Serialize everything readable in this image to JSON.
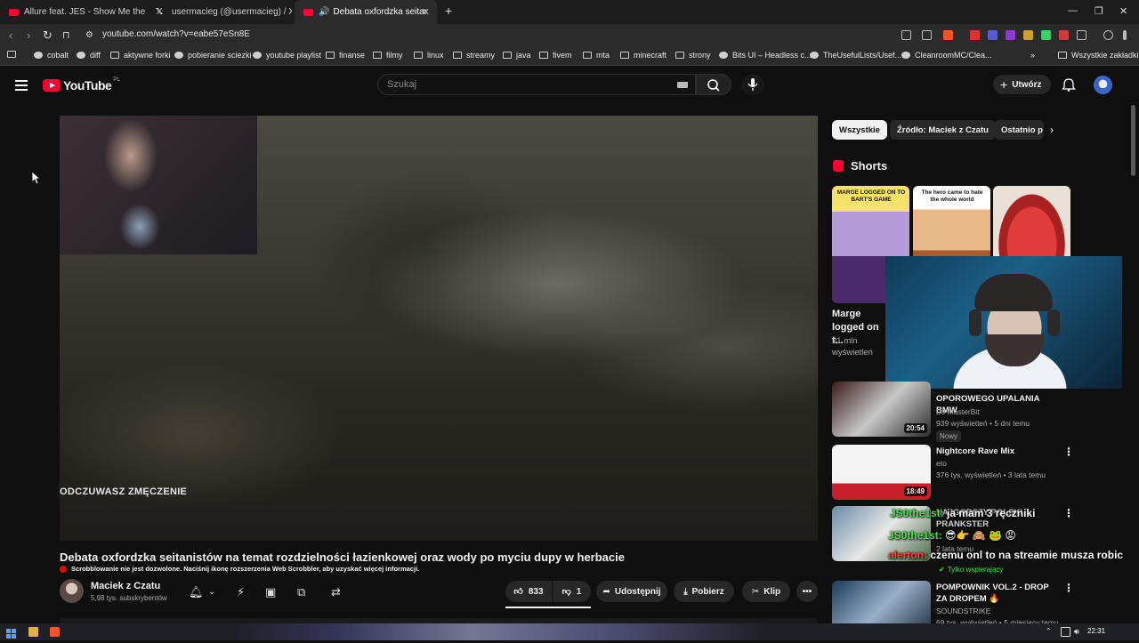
{
  "browser": {
    "tabs": [
      {
        "title": "Allure feat. JES - Show Me the Way (I"
      },
      {
        "title": "usermacieg (@usermacieg) / X"
      },
      {
        "title": "Debata oxfordzka seitanistów"
      }
    ],
    "url": "youtube.com/watch?v=eabe57eSn8E",
    "bookmarks": [
      "cobalt",
      "diff",
      "aktywne forki",
      "pobieranie sciezki",
      "youtube playlist",
      "finanse",
      "filmy",
      "linux",
      "streamy",
      "java",
      "fivem",
      "mta",
      "minecraft",
      "strony",
      "Bits UI – Headless c...",
      "TheUsefulLists/Usef...",
      "CleanroomMC/Clea..."
    ],
    "all_bookmarks": "Wszystkie zakładki"
  },
  "youtube": {
    "logo_text": "YouTube",
    "logo_region": "PL",
    "search_placeholder": "Szukaj",
    "create_label": "Utwórz"
  },
  "video": {
    "subtitle_text": "ODCZUWASZ ZMĘCZENIE",
    "title": "Debata oxfordzka seitanistów na temat rozdzielności łazienkowej oraz wody po myciu dupy w herbacie",
    "scrobbler_note": "Scrobblowanie nie jest dozwolone. Naciśnij ikonę rozszerzenia Web Scrobbler, aby uzyskać więcej informacji.",
    "channel_name": "Maciek z Czatu",
    "channel_subs": "5,98 tys. subskrybentów",
    "likes": "833",
    "dislikes": "1",
    "share_label": "Udostępnij",
    "download_label": "Pobierz",
    "clip_label": "Klip"
  },
  "sidebar": {
    "chips": [
      "Wszystkie",
      "Źródło: Maciek z Czatu",
      "Ostatnio p"
    ],
    "shorts_heading": "Shorts",
    "shorts": [
      {
        "caption": "MARGE LOGGED ON TO BART'S GAME",
        "title": "Marge logged on t...",
        "views": "21 mln wyświetleń"
      },
      {
        "caption": "The hero came to hate the whole world"
      },
      {
        "caption": ""
      }
    ],
    "recommendations": [
      {
        "title_fragment": "OPOROWEGO UPALANIA BMW",
        "channel": "DJ MasterBit",
        "meta": "939 wyświetleń • 5 dni temu",
        "duration": "20:54",
        "badge": "Nowy"
      },
      {
        "title": "Nightcore Rave Mix",
        "channel": "eto",
        "meta": "376 tys. wyświetleń • 3 lata temu",
        "duration": "18:49"
      },
      {
        "title": "NAJGORSZY POLSKI PRANKSTER",
        "meta": "2 lata temu"
      },
      {
        "title": "POMPOWNIK VOL.2 - DROP ZA DROPEM 🔥",
        "channel": "SOUNDSTRIKE",
        "meta": "69 tys. wyświetleń • 5 miesięcy temu"
      }
    ]
  },
  "chat": [
    {
      "nick": "JS0the1st:",
      "text": "ja mam 3 ręczniki"
    },
    {
      "nick": "JS0the1st:",
      "text": "😎👉 🙈 🐸 😡"
    },
    {
      "nick": "alerton:",
      "text": "czemu onl to na streamie musza robic"
    }
  ],
  "chat_badge": "Tylko wspierający",
  "taskbar": {
    "time": "22:31"
  }
}
